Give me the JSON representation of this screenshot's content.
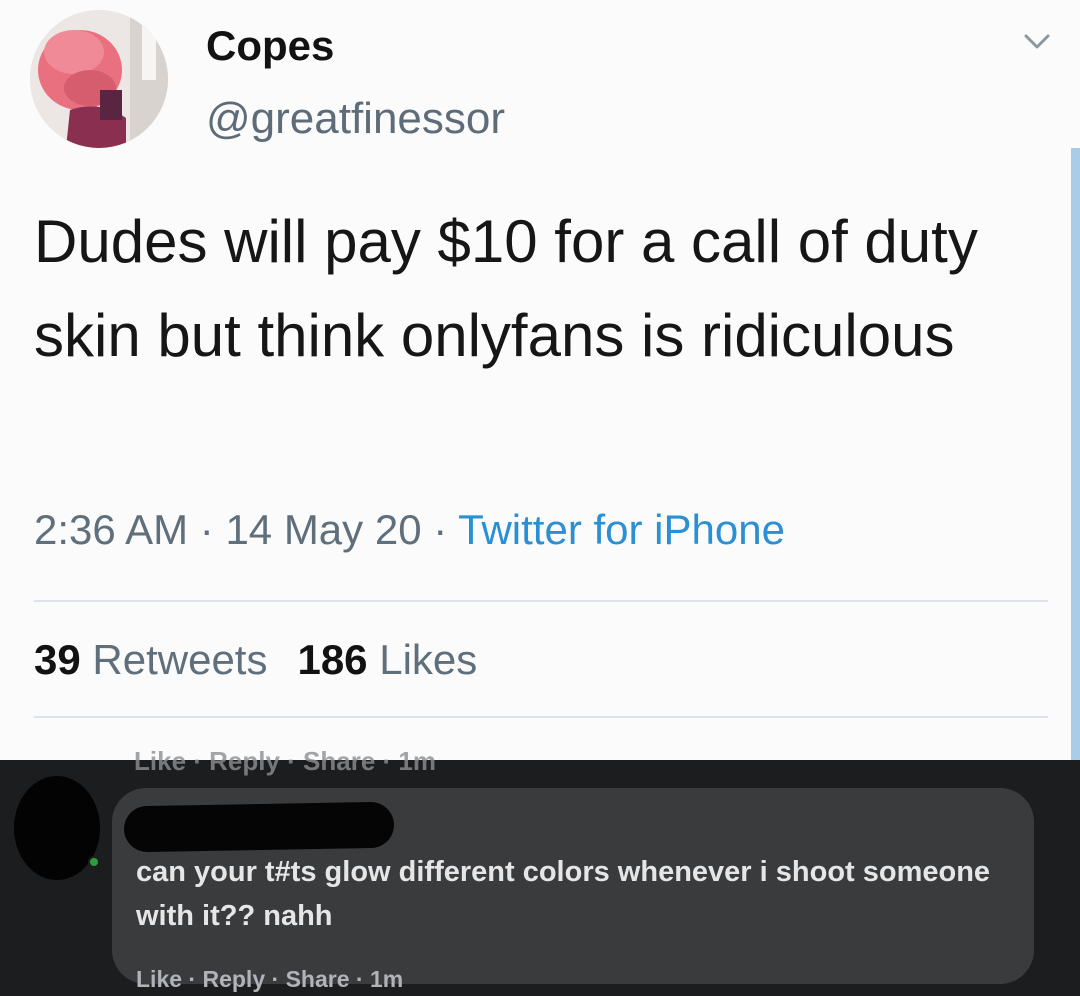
{
  "tweet": {
    "display_name": "Copes",
    "handle": "@greatfinessor",
    "text": "Dudes will pay $10 for a call of duty skin but think onlyfans is ridiculous",
    "time": "2:36 AM",
    "separator": " · ",
    "date": "14 May 20",
    "source": "Twitter for iPhone",
    "retweets_count": "39",
    "retweets_label": "Retweets",
    "likes_count": "186",
    "likes_label": "Likes",
    "colors": {
      "link": "#2b8fd3",
      "muted": "#5f6f7b",
      "text": "#161616"
    }
  },
  "comment_section": {
    "previous_comment_actions": "Like · Reply · Share · 1m",
    "comment_text": "can your t#ts glow different colors whenever i shoot someone with it?? nahh",
    "actions": {
      "like": "Like",
      "sep": " · ",
      "reply": "Reply",
      "share": "Share",
      "time": "1m"
    },
    "colors": {
      "background": "#1c1d1f",
      "bubble": "#3a3b3d",
      "text": "#e6e6e6"
    }
  }
}
